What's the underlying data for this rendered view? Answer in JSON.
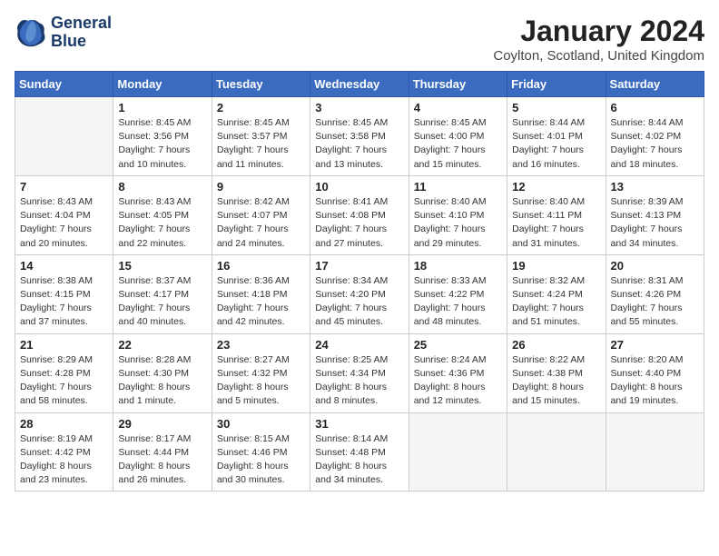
{
  "logo": {
    "line1": "General",
    "line2": "Blue"
  },
  "title": "January 2024",
  "location": "Coylton, Scotland, United Kingdom",
  "weekdays": [
    "Sunday",
    "Monday",
    "Tuesday",
    "Wednesday",
    "Thursday",
    "Friday",
    "Saturday"
  ],
  "weeks": [
    [
      {
        "num": "",
        "info": "",
        "empty": true
      },
      {
        "num": "1",
        "info": "Sunrise: 8:45 AM\nSunset: 3:56 PM\nDaylight: 7 hours\nand 10 minutes."
      },
      {
        "num": "2",
        "info": "Sunrise: 8:45 AM\nSunset: 3:57 PM\nDaylight: 7 hours\nand 11 minutes."
      },
      {
        "num": "3",
        "info": "Sunrise: 8:45 AM\nSunset: 3:58 PM\nDaylight: 7 hours\nand 13 minutes."
      },
      {
        "num": "4",
        "info": "Sunrise: 8:45 AM\nSunset: 4:00 PM\nDaylight: 7 hours\nand 15 minutes."
      },
      {
        "num": "5",
        "info": "Sunrise: 8:44 AM\nSunset: 4:01 PM\nDaylight: 7 hours\nand 16 minutes."
      },
      {
        "num": "6",
        "info": "Sunrise: 8:44 AM\nSunset: 4:02 PM\nDaylight: 7 hours\nand 18 minutes."
      }
    ],
    [
      {
        "num": "7",
        "info": "Sunrise: 8:43 AM\nSunset: 4:04 PM\nDaylight: 7 hours\nand 20 minutes."
      },
      {
        "num": "8",
        "info": "Sunrise: 8:43 AM\nSunset: 4:05 PM\nDaylight: 7 hours\nand 22 minutes."
      },
      {
        "num": "9",
        "info": "Sunrise: 8:42 AM\nSunset: 4:07 PM\nDaylight: 7 hours\nand 24 minutes."
      },
      {
        "num": "10",
        "info": "Sunrise: 8:41 AM\nSunset: 4:08 PM\nDaylight: 7 hours\nand 27 minutes."
      },
      {
        "num": "11",
        "info": "Sunrise: 8:40 AM\nSunset: 4:10 PM\nDaylight: 7 hours\nand 29 minutes."
      },
      {
        "num": "12",
        "info": "Sunrise: 8:40 AM\nSunset: 4:11 PM\nDaylight: 7 hours\nand 31 minutes."
      },
      {
        "num": "13",
        "info": "Sunrise: 8:39 AM\nSunset: 4:13 PM\nDaylight: 7 hours\nand 34 minutes."
      }
    ],
    [
      {
        "num": "14",
        "info": "Sunrise: 8:38 AM\nSunset: 4:15 PM\nDaylight: 7 hours\nand 37 minutes."
      },
      {
        "num": "15",
        "info": "Sunrise: 8:37 AM\nSunset: 4:17 PM\nDaylight: 7 hours\nand 40 minutes."
      },
      {
        "num": "16",
        "info": "Sunrise: 8:36 AM\nSunset: 4:18 PM\nDaylight: 7 hours\nand 42 minutes."
      },
      {
        "num": "17",
        "info": "Sunrise: 8:34 AM\nSunset: 4:20 PM\nDaylight: 7 hours\nand 45 minutes."
      },
      {
        "num": "18",
        "info": "Sunrise: 8:33 AM\nSunset: 4:22 PM\nDaylight: 7 hours\nand 48 minutes."
      },
      {
        "num": "19",
        "info": "Sunrise: 8:32 AM\nSunset: 4:24 PM\nDaylight: 7 hours\nand 51 minutes."
      },
      {
        "num": "20",
        "info": "Sunrise: 8:31 AM\nSunset: 4:26 PM\nDaylight: 7 hours\nand 55 minutes."
      }
    ],
    [
      {
        "num": "21",
        "info": "Sunrise: 8:29 AM\nSunset: 4:28 PM\nDaylight: 7 hours\nand 58 minutes."
      },
      {
        "num": "22",
        "info": "Sunrise: 8:28 AM\nSunset: 4:30 PM\nDaylight: 8 hours\nand 1 minute."
      },
      {
        "num": "23",
        "info": "Sunrise: 8:27 AM\nSunset: 4:32 PM\nDaylight: 8 hours\nand 5 minutes."
      },
      {
        "num": "24",
        "info": "Sunrise: 8:25 AM\nSunset: 4:34 PM\nDaylight: 8 hours\nand 8 minutes."
      },
      {
        "num": "25",
        "info": "Sunrise: 8:24 AM\nSunset: 4:36 PM\nDaylight: 8 hours\nand 12 minutes."
      },
      {
        "num": "26",
        "info": "Sunrise: 8:22 AM\nSunset: 4:38 PM\nDaylight: 8 hours\nand 15 minutes."
      },
      {
        "num": "27",
        "info": "Sunrise: 8:20 AM\nSunset: 4:40 PM\nDaylight: 8 hours\nand 19 minutes."
      }
    ],
    [
      {
        "num": "28",
        "info": "Sunrise: 8:19 AM\nSunset: 4:42 PM\nDaylight: 8 hours\nand 23 minutes."
      },
      {
        "num": "29",
        "info": "Sunrise: 8:17 AM\nSunset: 4:44 PM\nDaylight: 8 hours\nand 26 minutes."
      },
      {
        "num": "30",
        "info": "Sunrise: 8:15 AM\nSunset: 4:46 PM\nDaylight: 8 hours\nand 30 minutes."
      },
      {
        "num": "31",
        "info": "Sunrise: 8:14 AM\nSunset: 4:48 PM\nDaylight: 8 hours\nand 34 minutes."
      },
      {
        "num": "",
        "info": "",
        "empty": true
      },
      {
        "num": "",
        "info": "",
        "empty": true
      },
      {
        "num": "",
        "info": "",
        "empty": true
      }
    ]
  ]
}
